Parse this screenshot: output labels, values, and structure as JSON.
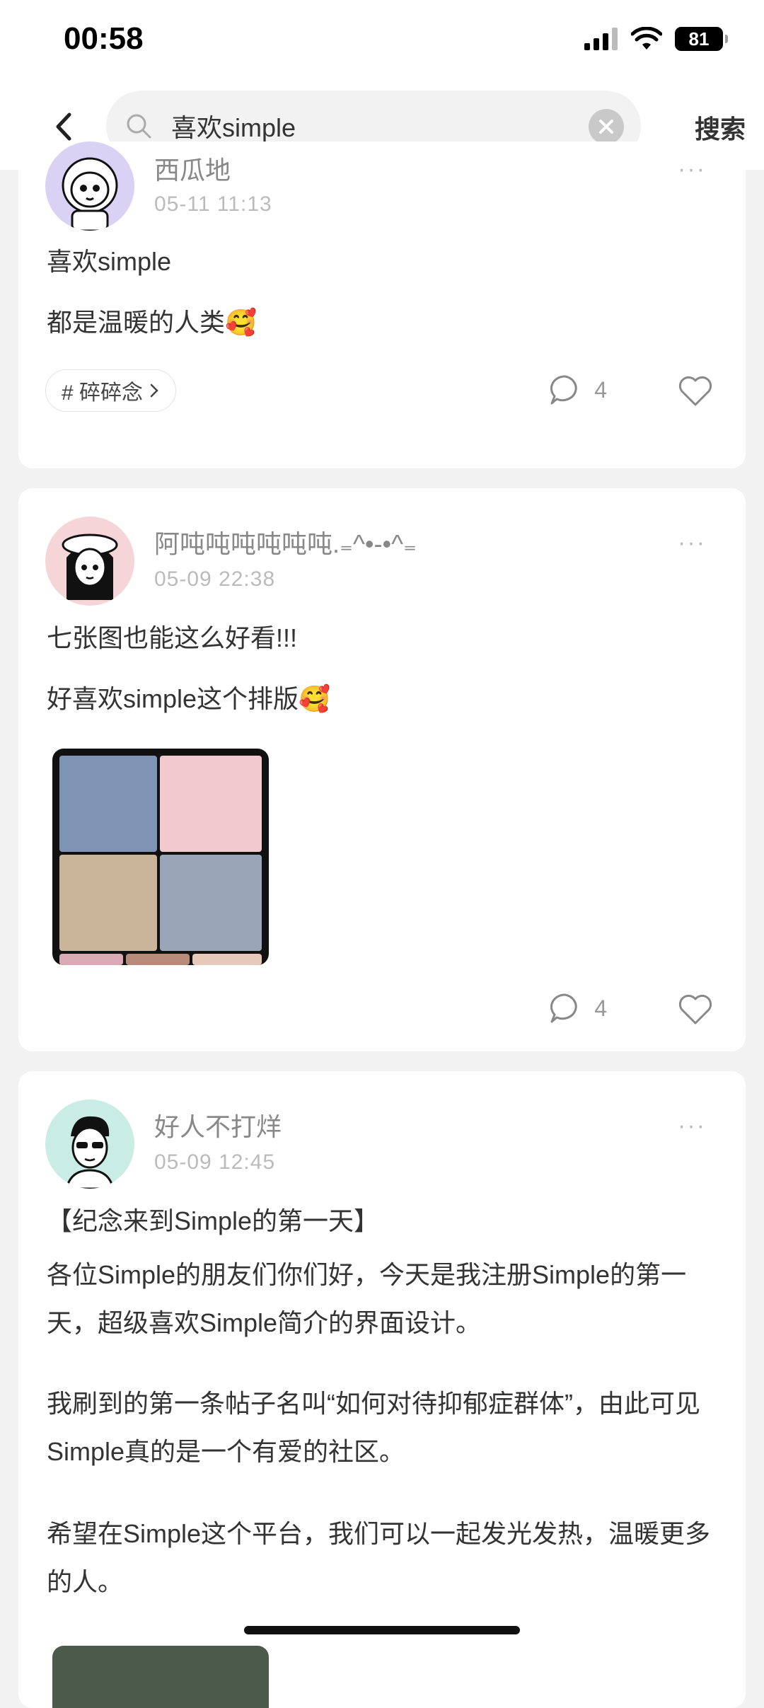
{
  "status": {
    "time": "00:58",
    "battery": "81"
  },
  "search": {
    "query": "喜欢simple",
    "button_label": "搜索"
  },
  "posts": [
    {
      "author": "西瓜地",
      "time": "05-11 11:13",
      "lines": [
        "喜欢simple",
        "都是温暖的人类🥰"
      ],
      "tag": "# 碎碎念",
      "comments": "4"
    },
    {
      "author": "阿吨吨吨吨吨吨.₌^•-•^₌",
      "time": "05-09 22:38",
      "lines": [
        "七张图也能这么好看!!!",
        "好喜欢simple这个排版🥰"
      ],
      "comments": "4"
    },
    {
      "author": "好人不打烊",
      "time": "05-09 12:45",
      "title": "【纪念来到Simple的第一天】",
      "paragraphs": [
        "各位Simple的朋友们你们好，今天是我注册Simple的第一天，超级喜欢Simple简介的界面设计。",
        "我刷到的第一条帖子名叫“如何对待抑郁症群体”，由此可见Simple真的是一个有爱的社区。",
        "希望在Simple这个平台，我们可以一起发光发热，温暖更多的人。"
      ]
    }
  ],
  "colors": {
    "accent_avatar_1": "#d9d2f5",
    "accent_avatar_2": "#f6d5d8",
    "accent_avatar_3": "#c9ece4"
  }
}
